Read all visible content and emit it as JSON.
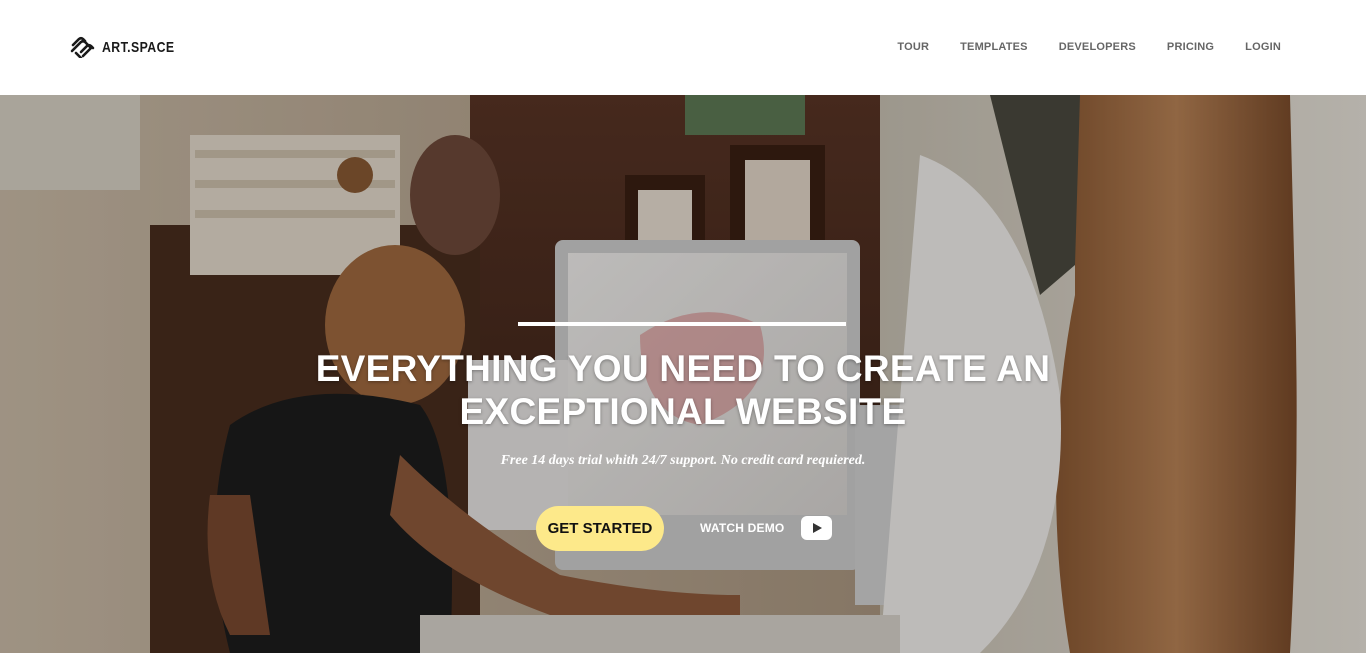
{
  "brand": {
    "name": "ART.SPACE",
    "logo_icon": "art-space-logo-icon"
  },
  "nav": {
    "items": [
      {
        "label": "TOUR"
      },
      {
        "label": "TEMPLATES"
      },
      {
        "label": "DEVELOPERS"
      },
      {
        "label": "PRICING"
      },
      {
        "label": "LOGIN"
      }
    ]
  },
  "hero": {
    "title": "EVERYTHING YOU NEED TO CREATE AN EXCEPTIONAL WEBSITE",
    "subtitle": "Free 14 days trial whith 24/7 support. No credit card requiered.",
    "cta_label": "GET STARTED",
    "demo_label": "WATCH DEMO",
    "demo_icon": "play-icon",
    "background": "photo of an artist working at a desktop computer in a studio"
  },
  "colors": {
    "cta_background": "#fde98a",
    "nav_text": "#666666",
    "header_background": "#ffffff"
  }
}
